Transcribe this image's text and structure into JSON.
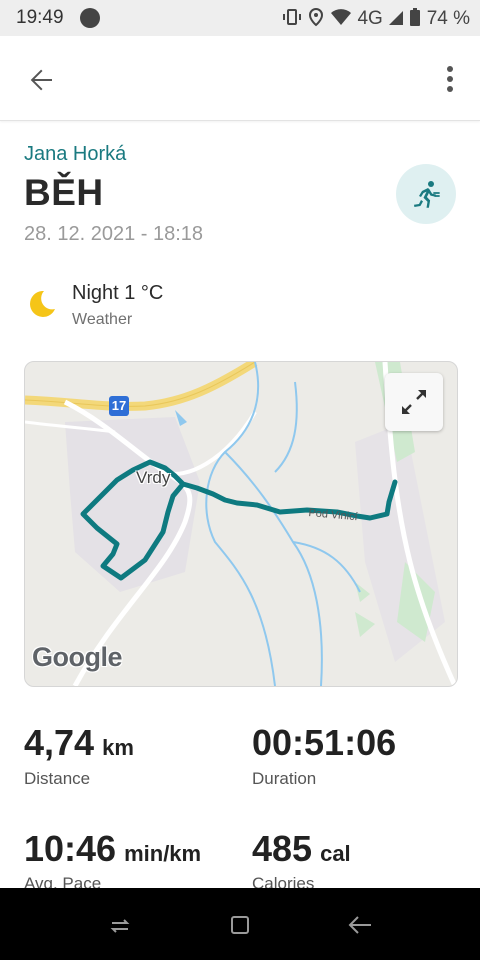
{
  "status_bar": {
    "time": "19:49",
    "battery": "74 %",
    "network": "4G"
  },
  "header": {
    "user_name": "Jana Horká",
    "activity_title": "BĚH",
    "date_time": "28. 12. 2021 - 18:18",
    "activity_icon": "running-icon"
  },
  "weather": {
    "condition": "Night 1 °C",
    "label": "Weather",
    "icon": "moon-icon"
  },
  "map": {
    "town_label": "Vrdy",
    "street_label": "Pod Vinicí",
    "road_shield": "17",
    "attribution": "Google",
    "colors": {
      "route": "#0e7a80",
      "road_major": "#f3d87a",
      "water": "#8fc8ee",
      "park": "#cfe9cf"
    }
  },
  "stats": [
    {
      "value": "4,74",
      "unit": "km",
      "label": "Distance"
    },
    {
      "value": "00:51:06",
      "unit": "",
      "label": "Duration"
    },
    {
      "value": "10:46",
      "unit": "min/km",
      "label": "Avg. Pace"
    },
    {
      "value": "485",
      "unit": "cal",
      "label": "Calories"
    }
  ],
  "colors": {
    "accent": "#1a7a80",
    "badge_bg": "#dff0f1",
    "moon": "#f5c518"
  }
}
